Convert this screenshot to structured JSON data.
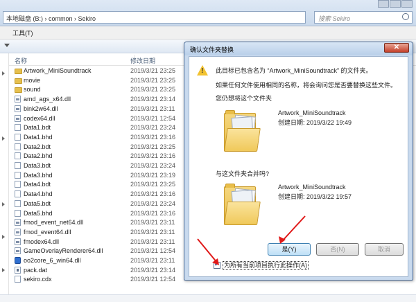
{
  "explorer": {
    "breadcrumb": [
      "本地磁盘 (B:)",
      "common",
      "Sekiro"
    ],
    "search_placeholder": "搜索 Sekiro",
    "menu": [
      "工具(T)"
    ],
    "columns": {
      "name": "名称",
      "date": "修改日期"
    },
    "files": [
      {
        "name": "Artwork_MiniSoundtrack",
        "date": "2019/3/21 23:25",
        "type": "folder"
      },
      {
        "name": "movie",
        "date": "2019/3/21 23:25",
        "type": "folder"
      },
      {
        "name": "sound",
        "date": "2019/3/21 23:25",
        "type": "folder"
      },
      {
        "name": "amd_ags_x64.dll",
        "date": "2019/3/21 23:14",
        "type": "dll"
      },
      {
        "name": "bink2w64.dll",
        "date": "2019/3/21 23:11",
        "type": "dll"
      },
      {
        "name": "codex64.dll",
        "date": "2019/3/21 12:54",
        "type": "dll"
      },
      {
        "name": "Data1.bdt",
        "date": "2019/3/21 23:24",
        "type": "file"
      },
      {
        "name": "Data1.bhd",
        "date": "2019/3/21 23:16",
        "type": "file"
      },
      {
        "name": "Data2.bdt",
        "date": "2019/3/21 23:25",
        "type": "file"
      },
      {
        "name": "Data2.bhd",
        "date": "2019/3/21 23:16",
        "type": "file"
      },
      {
        "name": "Data3.bdt",
        "date": "2019/3/21 23:24",
        "type": "file"
      },
      {
        "name": "Data3.bhd",
        "date": "2019/3/21 23:19",
        "type": "file"
      },
      {
        "name": "Data4.bdt",
        "date": "2019/3/21 23:25",
        "type": "file"
      },
      {
        "name": "Data4.bhd",
        "date": "2019/3/21 23:16",
        "type": "file"
      },
      {
        "name": "Data5.bdt",
        "date": "2019/3/21 23:24",
        "type": "file"
      },
      {
        "name": "Data5.bhd",
        "date": "2019/3/21 23:16",
        "type": "file"
      },
      {
        "name": "fmod_event_net64.dll",
        "date": "2019/3/21 23:11",
        "type": "dll"
      },
      {
        "name": "fmod_event64.dll",
        "date": "2019/3/21 23:11",
        "type": "dll"
      },
      {
        "name": "fmodex64.dll",
        "date": "2019/3/21 23:11",
        "type": "dll"
      },
      {
        "name": "GameOverlayRenderer64.dll",
        "date": "2019/3/21 12:54",
        "type": "dll"
      },
      {
        "name": "oo2core_6_win64.dll",
        "date": "2019/3/21 23:11",
        "type": "exe"
      },
      {
        "name": "pack.dat",
        "date": "2019/3/21 23:14",
        "type": "dat"
      },
      {
        "name": "sekiro.cdx",
        "date": "2019/3/21 12:54",
        "type": "file"
      }
    ]
  },
  "dialog": {
    "title": "确认文件夹替换",
    "close_glyph": "✕",
    "message_line1": "此目标已包含名为 “Artwork_MiniSoundtrack” 的文件夹。",
    "message_line2": "如果任何文件使用相同的名称，将会询问您是否要替换这些文件。",
    "message_line3": "您仍想将这个文件夹",
    "existing": {
      "name": "Artwork_MiniSoundtrack",
      "created": "创建日期: 2019/3/22 19:49"
    },
    "merge_question": "与这文件夹合并吗?",
    "incoming": {
      "name": "Artwork_MiniSoundtrack",
      "created": "创建日期: 2019/3/22 19:57"
    },
    "yes_button": "是(Y)",
    "no_button": "否(N)",
    "cancel_button": "取消",
    "apply_all_label": "为所有当前项目执行此操作(A)"
  }
}
